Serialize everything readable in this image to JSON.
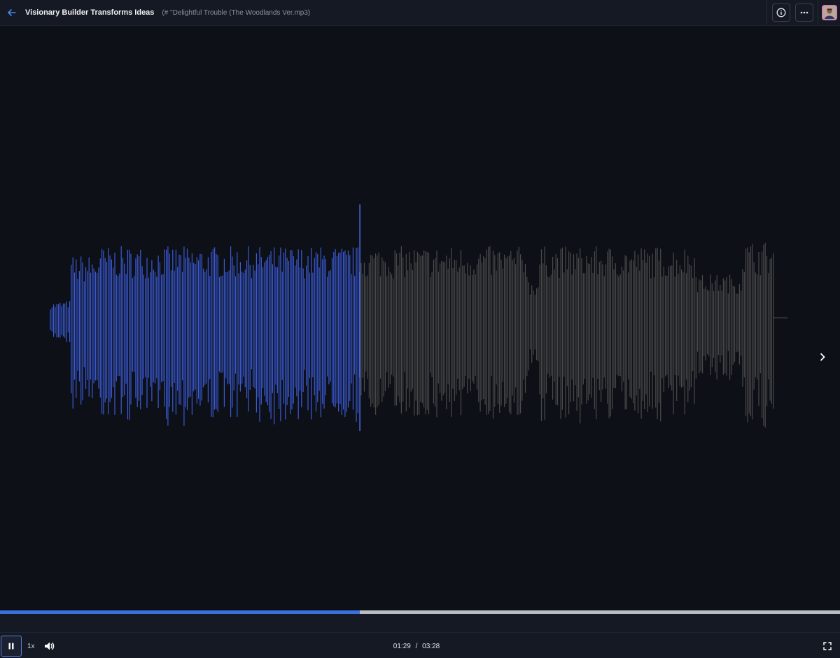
{
  "header": {
    "title": "Visionary Builder Transforms Ideas",
    "subtitle": "(# \"Delightful Trouble (The Woodlands Ver.mp3)",
    "back_icon": "arrow-left-icon",
    "info_icon": "info-icon",
    "more_icon": "more-horizontal-icon"
  },
  "player": {
    "current_time": "01:29",
    "separator": "/",
    "duration": "03:28",
    "speed": "1x",
    "played_fraction": 0.428,
    "played_color": "#3b5bd6",
    "unplayed_color": "#4a4a4a",
    "progress_color": "#3b6fdb",
    "play_state": "playing"
  },
  "icons": {
    "pause": "pause-icon",
    "volume": "volume-icon",
    "fullscreen": "fullscreen-icon",
    "next": "chevron-right-icon"
  }
}
